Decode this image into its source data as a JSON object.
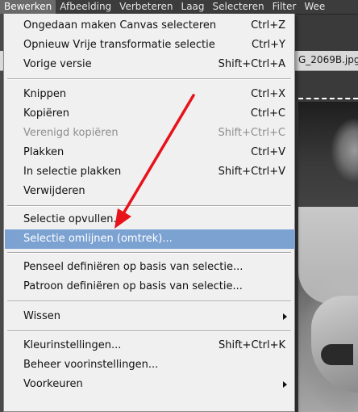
{
  "menubar": {
    "items": [
      "Bewerken",
      "Afbeelding",
      "Verbeteren",
      "Laag",
      "Selecteren",
      "Filter",
      "Wee"
    ]
  },
  "document": {
    "tab_title": "G_2069B.jpg"
  },
  "edit_menu": {
    "items": [
      {
        "label": "Ongedaan maken Canvas selecteren",
        "shortcut": "Ctrl+Z"
      },
      {
        "label": "Opnieuw Vrije transformatie selectie",
        "shortcut": "Ctrl+Y"
      },
      {
        "label": "Vorige versie",
        "shortcut": "Shift+Ctrl+A"
      },
      {
        "label": "Knippen",
        "shortcut": "Ctrl+X"
      },
      {
        "label": "Kopiëren",
        "shortcut": "Ctrl+C"
      },
      {
        "label": "Verenigd kopiëren",
        "shortcut": "Shift+Ctrl+C",
        "disabled": true
      },
      {
        "label": "Plakken",
        "shortcut": "Ctrl+V"
      },
      {
        "label": "In selectie plakken",
        "shortcut": "Shift+Ctrl+V"
      },
      {
        "label": "Verwijderen",
        "shortcut": ""
      },
      {
        "label": "Selectie opvullen...",
        "shortcut": ""
      },
      {
        "label": "Selectie omlijnen (omtrek)...",
        "shortcut": "",
        "highlighted": true
      },
      {
        "label": "Penseel definiëren op basis van selectie...",
        "shortcut": ""
      },
      {
        "label": "Patroon definiëren op basis van selectie...",
        "shortcut": ""
      },
      {
        "label": "Wissen",
        "shortcut": "",
        "submenu": true
      },
      {
        "label": "Kleurinstellingen...",
        "shortcut": "Shift+Ctrl+K"
      },
      {
        "label": "Beheer voorinstellingen...",
        "shortcut": ""
      },
      {
        "label": "Voorkeuren",
        "shortcut": "",
        "submenu": true
      }
    ]
  },
  "colors": {
    "highlight": "#7ca2d2",
    "annotation_arrow": "#e8121a",
    "menu_bg": "#f0f0f0",
    "menubar_bg": "#3c3c3c"
  }
}
